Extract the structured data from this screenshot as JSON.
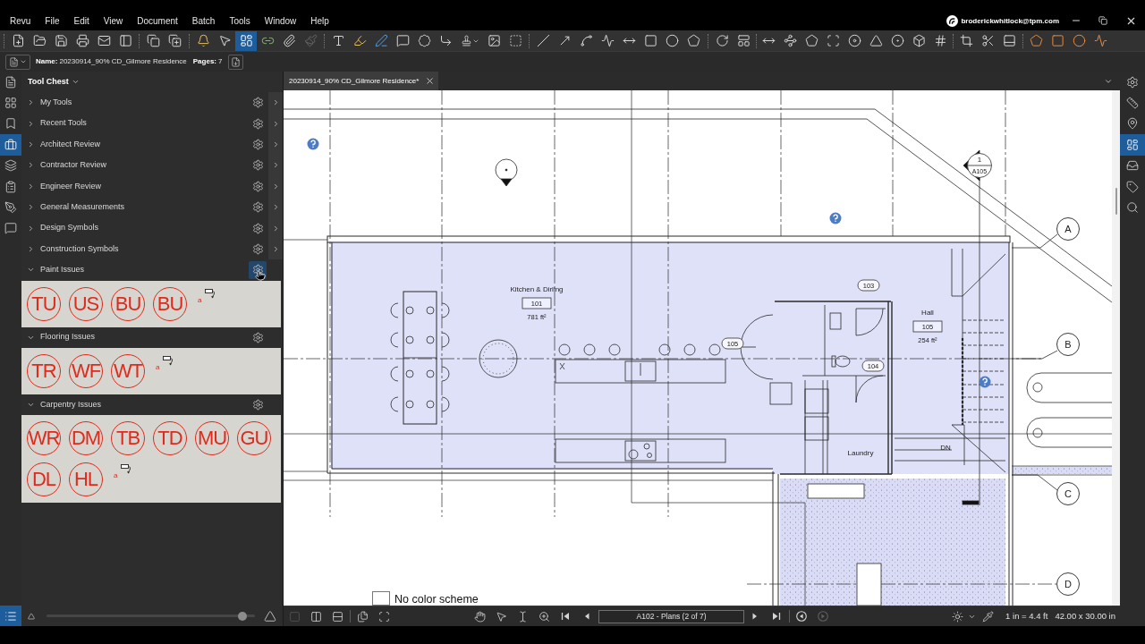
{
  "menu_bar": {
    "items": [
      "Revu",
      "File",
      "Edit",
      "View",
      "Document",
      "Batch",
      "Tools",
      "Window",
      "Help"
    ],
    "account": "broderickwhitlock@tpm.com"
  },
  "toolbar": {
    "groups": [
      [
        {
          "kind": "new-file",
          "selected": false,
          "disabled": false
        },
        {
          "kind": "open",
          "selected": false,
          "disabled": false
        },
        {
          "kind": "save",
          "selected": false,
          "disabled": false
        },
        {
          "kind": "print",
          "selected": false,
          "disabled": false
        },
        {
          "kind": "email",
          "selected": false,
          "disabled": false
        },
        {
          "kind": "page-view",
          "selected": false,
          "disabled": false
        }
      ],
      [
        {
          "kind": "compare",
          "selected": false,
          "disabled": false
        },
        {
          "kind": "overlay",
          "selected": false,
          "disabled": false
        }
      ],
      [
        {
          "kind": "snapshot",
          "selected": false,
          "disabled": false
        },
        {
          "kind": "select",
          "selected": false,
          "disabled": false
        },
        {
          "kind": "spaces",
          "selected": true,
          "disabled": false
        },
        {
          "kind": "link",
          "selected": false,
          "disabled": false
        },
        {
          "kind": "attach",
          "selected": false,
          "disabled": false
        },
        {
          "kind": "format-painter",
          "selected": false,
          "disabled": true
        }
      ],
      [
        {
          "kind": "text-box",
          "selected": false,
          "disabled": false
        },
        {
          "kind": "highlight",
          "selected": false,
          "disabled": false
        },
        {
          "kind": "pen",
          "selected": false,
          "disabled": false
        },
        {
          "kind": "callout",
          "selected": false,
          "disabled": false
        },
        {
          "kind": "cloud",
          "selected": false,
          "disabled": false
        },
        {
          "kind": "arrow-callout",
          "selected": false,
          "disabled": false
        },
        {
          "kind": "stamp",
          "selected": false,
          "disabled": false
        },
        {
          "kind": "image",
          "selected": false,
          "disabled": false
        },
        {
          "kind": "crop",
          "selected": false,
          "disabled": false
        }
      ],
      [
        {
          "kind": "line",
          "selected": false,
          "disabled": false
        },
        {
          "kind": "arrow",
          "selected": false,
          "disabled": false
        },
        {
          "kind": "arc",
          "selected": false,
          "disabled": false
        },
        {
          "kind": "polyline",
          "selected": false,
          "disabled": false
        },
        {
          "kind": "dimension",
          "selected": false,
          "disabled": false
        },
        {
          "kind": "rectangle",
          "selected": false,
          "disabled": false
        },
        {
          "kind": "ellipse",
          "selected": false,
          "disabled": false
        },
        {
          "kind": "polygon",
          "selected": false,
          "disabled": false
        }
      ],
      [
        {
          "kind": "rotate",
          "selected": false,
          "disabled": false
        },
        {
          "kind": "legend",
          "selected": false,
          "disabled": false
        }
      ],
      [
        {
          "kind": "length",
          "selected": false,
          "disabled": false
        },
        {
          "kind": "polylength",
          "selected": false,
          "disabled": false
        },
        {
          "kind": "perimeter",
          "selected": false,
          "disabled": false
        },
        {
          "kind": "area",
          "selected": false,
          "disabled": false
        },
        {
          "kind": "diameter",
          "selected": false,
          "disabled": false
        },
        {
          "kind": "angle",
          "selected": false,
          "disabled": false
        },
        {
          "kind": "radius",
          "selected": false,
          "disabled": false
        },
        {
          "kind": "volume",
          "selected": false,
          "disabled": false
        },
        {
          "kind": "count",
          "selected": false,
          "disabled": false
        }
      ],
      [
        {
          "kind": "cutout",
          "selected": false,
          "disabled": false
        },
        {
          "kind": "cut",
          "selected": false,
          "disabled": false
        },
        {
          "kind": "fill",
          "selected": false,
          "disabled": false
        }
      ],
      [
        {
          "kind": "space-polygon",
          "selected": false,
          "disabled": false
        },
        {
          "kind": "space-rectangle",
          "selected": false,
          "disabled": false
        },
        {
          "kind": "space-ellipse",
          "selected": false,
          "disabled": false
        },
        {
          "kind": "space-polyline",
          "selected": false,
          "disabled": false
        }
      ]
    ]
  },
  "file_bar": {
    "name_label": "Name:",
    "name": "20230914_90% CD_Gilmore Residence",
    "pages_label": "Pages:",
    "pages": "7"
  },
  "left_rail": {
    "tabs": [
      {
        "kind": "document",
        "selected": false
      },
      {
        "kind": "thumbnails",
        "selected": false
      },
      {
        "kind": "bookmarks",
        "selected": false
      },
      {
        "kind": "tool-chest",
        "selected": true
      },
      {
        "kind": "layers",
        "selected": false
      },
      {
        "kind": "forms",
        "selected": false
      },
      {
        "kind": "signatures",
        "selected": false
      },
      {
        "kind": "markups",
        "selected": false
      }
    ],
    "bottom": {
      "kind": "list",
      "selected": true
    }
  },
  "tool_chest": {
    "title": "Tool Chest",
    "sets": [
      {
        "name": "My Tools",
        "expanded": false,
        "hovered": false
      },
      {
        "name": "Recent Tools",
        "expanded": false,
        "hovered": false
      },
      {
        "name": "Architect Review",
        "expanded": false,
        "hovered": false
      },
      {
        "name": "Contractor Review",
        "expanded": false,
        "hovered": false
      },
      {
        "name": "Engineer Review",
        "expanded": false,
        "hovered": false
      },
      {
        "name": "General Measurements",
        "expanded": false,
        "hovered": false
      },
      {
        "name": "Design Symbols",
        "expanded": false,
        "hovered": false
      },
      {
        "name": "Construction Symbols",
        "expanded": false,
        "hovered": false
      },
      {
        "name": "Paint Issues",
        "expanded": true,
        "hovered": true,
        "tools": [
          {
            "kind": "stamp",
            "label": "TU"
          },
          {
            "kind": "stamp",
            "label": "US"
          },
          {
            "kind": "stamp",
            "label": "BU"
          },
          {
            "kind": "stamp",
            "label": "BU"
          },
          {
            "kind": "text",
            "label": "a"
          },
          {
            "kind": "callout"
          }
        ]
      },
      {
        "name": "Flooring Issues",
        "expanded": true,
        "hovered": false,
        "tools": [
          {
            "kind": "stamp",
            "label": "TR"
          },
          {
            "kind": "stamp",
            "label": "WF"
          },
          {
            "kind": "stamp",
            "label": "WT"
          },
          {
            "kind": "text",
            "label": "a"
          },
          {
            "kind": "callout"
          }
        ]
      },
      {
        "name": "Carpentry Issues",
        "expanded": true,
        "hovered": false,
        "tools": [
          {
            "kind": "stamp",
            "label": "WR"
          },
          {
            "kind": "stamp",
            "label": "DM"
          },
          {
            "kind": "stamp",
            "label": "TB"
          },
          {
            "kind": "stamp",
            "label": "TD"
          },
          {
            "kind": "stamp",
            "label": "MU"
          },
          {
            "kind": "stamp",
            "label": "GU"
          },
          {
            "kind": "stamp",
            "label": "DL"
          },
          {
            "kind": "stamp",
            "label": "HL"
          },
          {
            "kind": "text",
            "label": "a"
          },
          {
            "kind": "callout"
          }
        ]
      }
    ],
    "size_slider": {
      "level": 0.94
    }
  },
  "document_tabs": [
    {
      "title": "20230914_90% CD_Gilmore Residence*",
      "selected": true
    }
  ],
  "drawing": {
    "labels": [
      {
        "kind": "room-name",
        "text": "Kitchen & Dirling"
      },
      {
        "kind": "room-number",
        "text": "101"
      },
      {
        "kind": "area",
        "text": "781 ft²"
      },
      {
        "kind": "tag",
        "text": "103"
      },
      {
        "kind": "tag",
        "text": "105"
      },
      {
        "kind": "room-name",
        "text": "Hall"
      },
      {
        "kind": "room-number",
        "text": "105"
      },
      {
        "kind": "area",
        "text": "254 ft²"
      },
      {
        "kind": "tag",
        "text": "104"
      },
      {
        "kind": "room-name",
        "text": "Laundry"
      },
      {
        "kind": "note",
        "text": "DN"
      }
    ],
    "section_marker": {
      "number": "1",
      "sheet": "A105"
    },
    "grid_bubbles": [
      "A",
      "B",
      "C",
      "D"
    ],
    "legend": {
      "text": "No color scheme",
      "checked": false
    }
  },
  "right_rail": {
    "tabs": [
      {
        "kind": "properties",
        "selected": false
      },
      {
        "kind": "measurements",
        "selected": false
      },
      {
        "kind": "places",
        "selected": false
      },
      {
        "kind": "spaces",
        "selected": true
      },
      {
        "kind": "studio",
        "selected": false
      },
      {
        "kind": "tags",
        "selected": false
      },
      {
        "kind": "search",
        "selected": false
      }
    ]
  },
  "status_bar": {
    "view_buttons": [
      {
        "kind": "single",
        "disabled": true
      },
      {
        "kind": "columns",
        "disabled": false
      },
      {
        "kind": "rows",
        "disabled": false
      },
      {
        "kind": "files",
        "disabled": false
      },
      {
        "kind": "scan",
        "disabled": false
      }
    ],
    "tools": [
      {
        "kind": "pan"
      },
      {
        "kind": "select"
      },
      {
        "kind": "text-select"
      },
      {
        "kind": "zoom"
      }
    ],
    "page_nav": {
      "before": [
        {
          "kind": "first",
          "disabled": false
        },
        {
          "kind": "prev",
          "disabled": false
        }
      ],
      "page": "A102 - Plans (2 of 7)",
      "after": [
        {
          "kind": "next",
          "disabled": false
        },
        {
          "kind": "last",
          "disabled": false
        }
      ]
    },
    "history": [
      {
        "kind": "back",
        "disabled": false
      },
      {
        "kind": "forward",
        "disabled": true
      }
    ],
    "scale": "1 in = 4.4 ft",
    "size": "42.00 x 30.00 in"
  }
}
